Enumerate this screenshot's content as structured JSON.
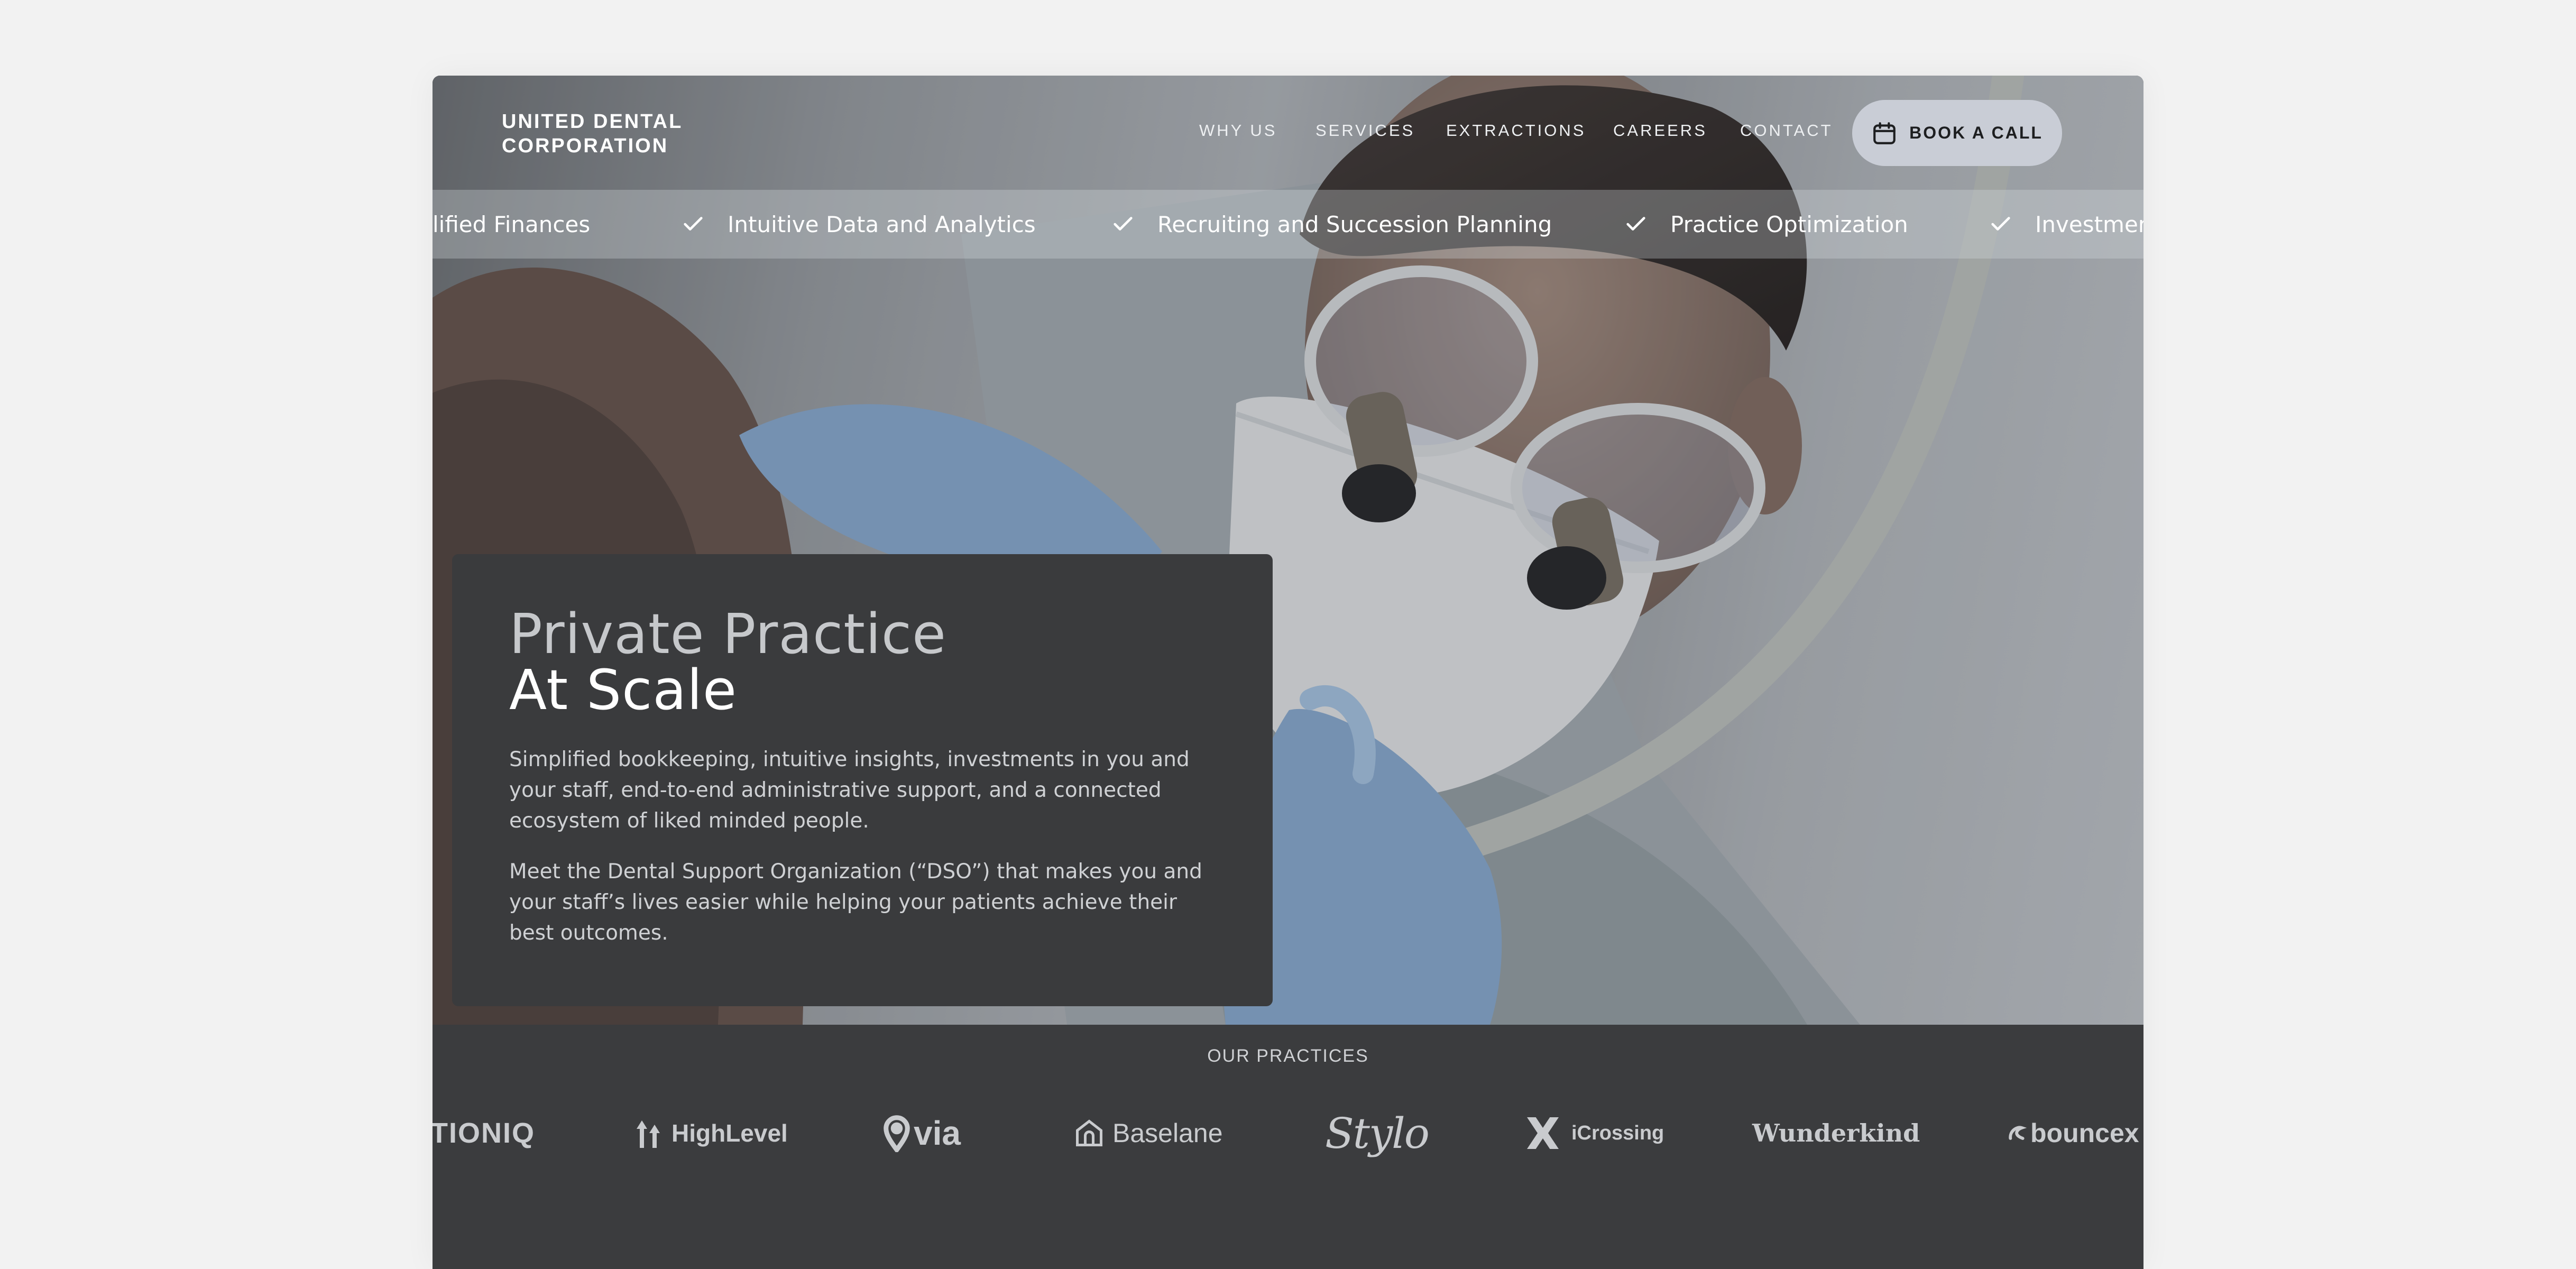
{
  "brand": {
    "line1": "UNITED DENTAL",
    "line2": "CORPORATION"
  },
  "nav": [
    {
      "label": "WHY US"
    },
    {
      "label": "SERVICES"
    },
    {
      "label": "EXTRACTIONS"
    },
    {
      "label": "CAREERS"
    },
    {
      "label": "CONTACT"
    }
  ],
  "cta": {
    "label": "BOOK A CALL",
    "icon": "calendar-icon"
  },
  "ticker": [
    {
      "label": "lified Finances",
      "icon": "none"
    },
    {
      "label": "Intuitive Data and Analytics",
      "icon": "check-icon"
    },
    {
      "label": "Recruiting and Succession Planning",
      "icon": "check-icon"
    },
    {
      "label": "Practice Optimization",
      "icon": "check-icon"
    },
    {
      "label": "Investment",
      "icon": "check-icon"
    }
  ],
  "hero": {
    "title_line1": "Private Practice",
    "title_line2": "At Scale",
    "paragraph1": "Simplified bookkeeping, intuitive insights, investments in you and your staff, end-to-end administrative support, and a connected ecosystem of liked minded people.",
    "paragraph2": "Meet the Dental Support Organization (“DSO”) that makes you and your staff’s lives easier while helping your patients achieve their best outcomes."
  },
  "practices": {
    "label": "OUR PRACTICES",
    "logos": [
      {
        "text": "TIONIQ",
        "icon": "motioniq-logo"
      },
      {
        "text": "HighLevel",
        "icon": "highlevel-logo"
      },
      {
        "text": "via",
        "icon": "via-pin-logo"
      },
      {
        "text": "Baselane",
        "icon": "baselane-house-logo"
      },
      {
        "text": "Stylo",
        "icon": "stylo-script-logo"
      },
      {
        "text": "iCrossing",
        "icon": "icrossing-x-logo"
      },
      {
        "text": "Wunderkind",
        "icon": "wunderkind-logo"
      },
      {
        "text": "bouncex",
        "icon": "bouncex-logo"
      }
    ]
  },
  "colors": {
    "page_bg": "#f2f2f2",
    "dark_panel": "#3a3b3d",
    "cta_bg": "#c9cdd6",
    "text_light": "#ffffff"
  }
}
